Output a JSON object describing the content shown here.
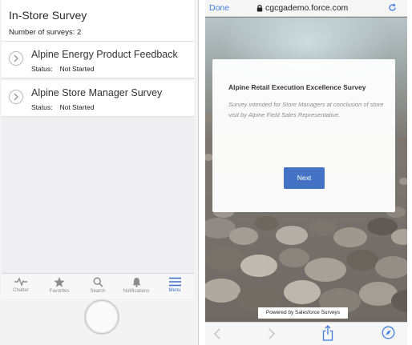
{
  "left_app": {
    "header": {
      "title": "In-Store Survey",
      "count_label": "Number of surveys:",
      "count_value": "2"
    },
    "surveys": [
      {
        "name": "Alpine Energy Product Feedback",
        "status_label": "Status:",
        "status": "Not Started"
      },
      {
        "name": "Alpine Store Manager Survey",
        "status_label": "Status:",
        "status": "Not Started"
      }
    ],
    "tabbar": {
      "active": "Menu",
      "tabs": [
        {
          "label": "Chatter",
          "icon": "pulse-icon"
        },
        {
          "label": "Favorites",
          "icon": "star-icon"
        },
        {
          "label": "Search",
          "icon": "search-icon"
        },
        {
          "label": "Notifications",
          "icon": "bell-icon"
        },
        {
          "label": "Menu",
          "icon": "hamburger-icon"
        }
      ]
    }
  },
  "right_app": {
    "browser": {
      "done_label": "Done",
      "url": "cgcgademo.force.com"
    },
    "card": {
      "title": "Alpine Retail Execution Excellence Survey",
      "description": "Survey intended for Store Managers at conclusion of store visit by Alpine Field Sales Representative.",
      "next_label": "Next"
    },
    "powered_by": {
      "prefix": "Powered by Salesforce",
      "brand": "Surveys"
    }
  },
  "colors": {
    "accent_blue": "#4472c4",
    "link_blue": "#3d7ee0",
    "active_tab": "#3a6fc6"
  }
}
